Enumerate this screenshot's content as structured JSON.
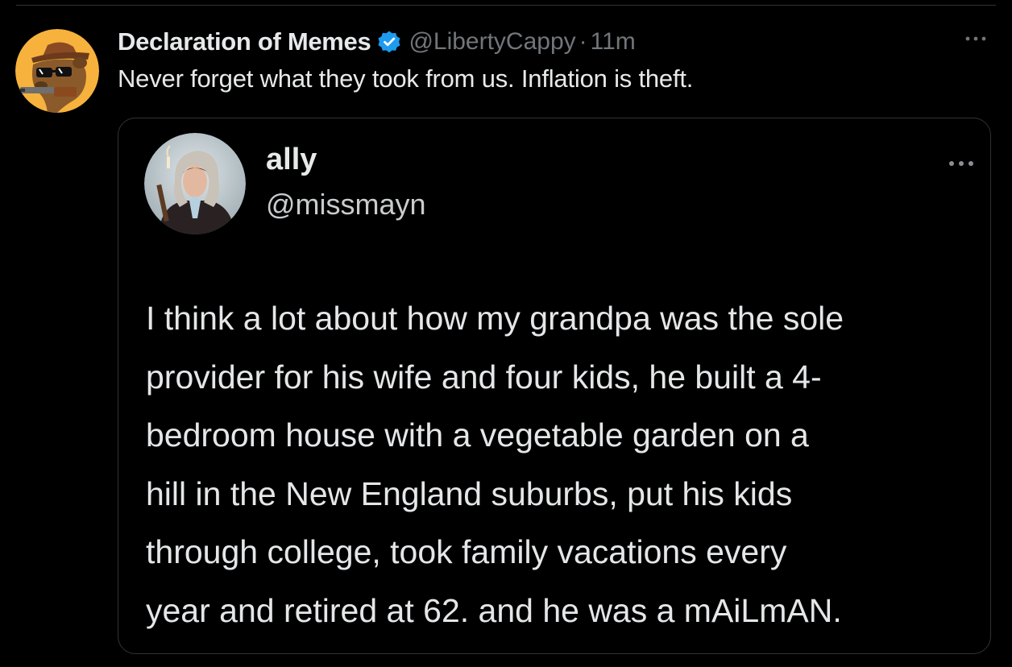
{
  "tweet": {
    "display_name": "Declaration of Memes",
    "handle": "@LibertyCappy",
    "separator": "·",
    "time": "11m",
    "text": "Never forget what they took from us. Inflation is theft.",
    "avatar_icon": "capybara-sunglasses-avatar",
    "verified_icon": "verified-badge-icon",
    "verified_color": "#1d9bf0",
    "more_icon": "more-options-icon"
  },
  "quoted_tweet": {
    "display_name": "ally",
    "handle": "@missmayn",
    "avatar_icon": "woman-headscarf-avatar",
    "more_icon": "more-options-icon",
    "body_lines": [
      "I think a lot about how my grandpa was the sole",
      "provider for his wife and four kids, he built a 4-",
      "bedroom house with a vegetable garden on a",
      "hill in the New England suburbs, put his kids",
      "through college, took family vacations every",
      "year and retired at 62. and he was a mAiLmAN."
    ]
  },
  "colors": {
    "background": "#000000",
    "primary_text": "#e7e9ea",
    "secondary_text": "#71767b",
    "border": "#2f3336",
    "avatar_orange": "#f6b23c"
  }
}
